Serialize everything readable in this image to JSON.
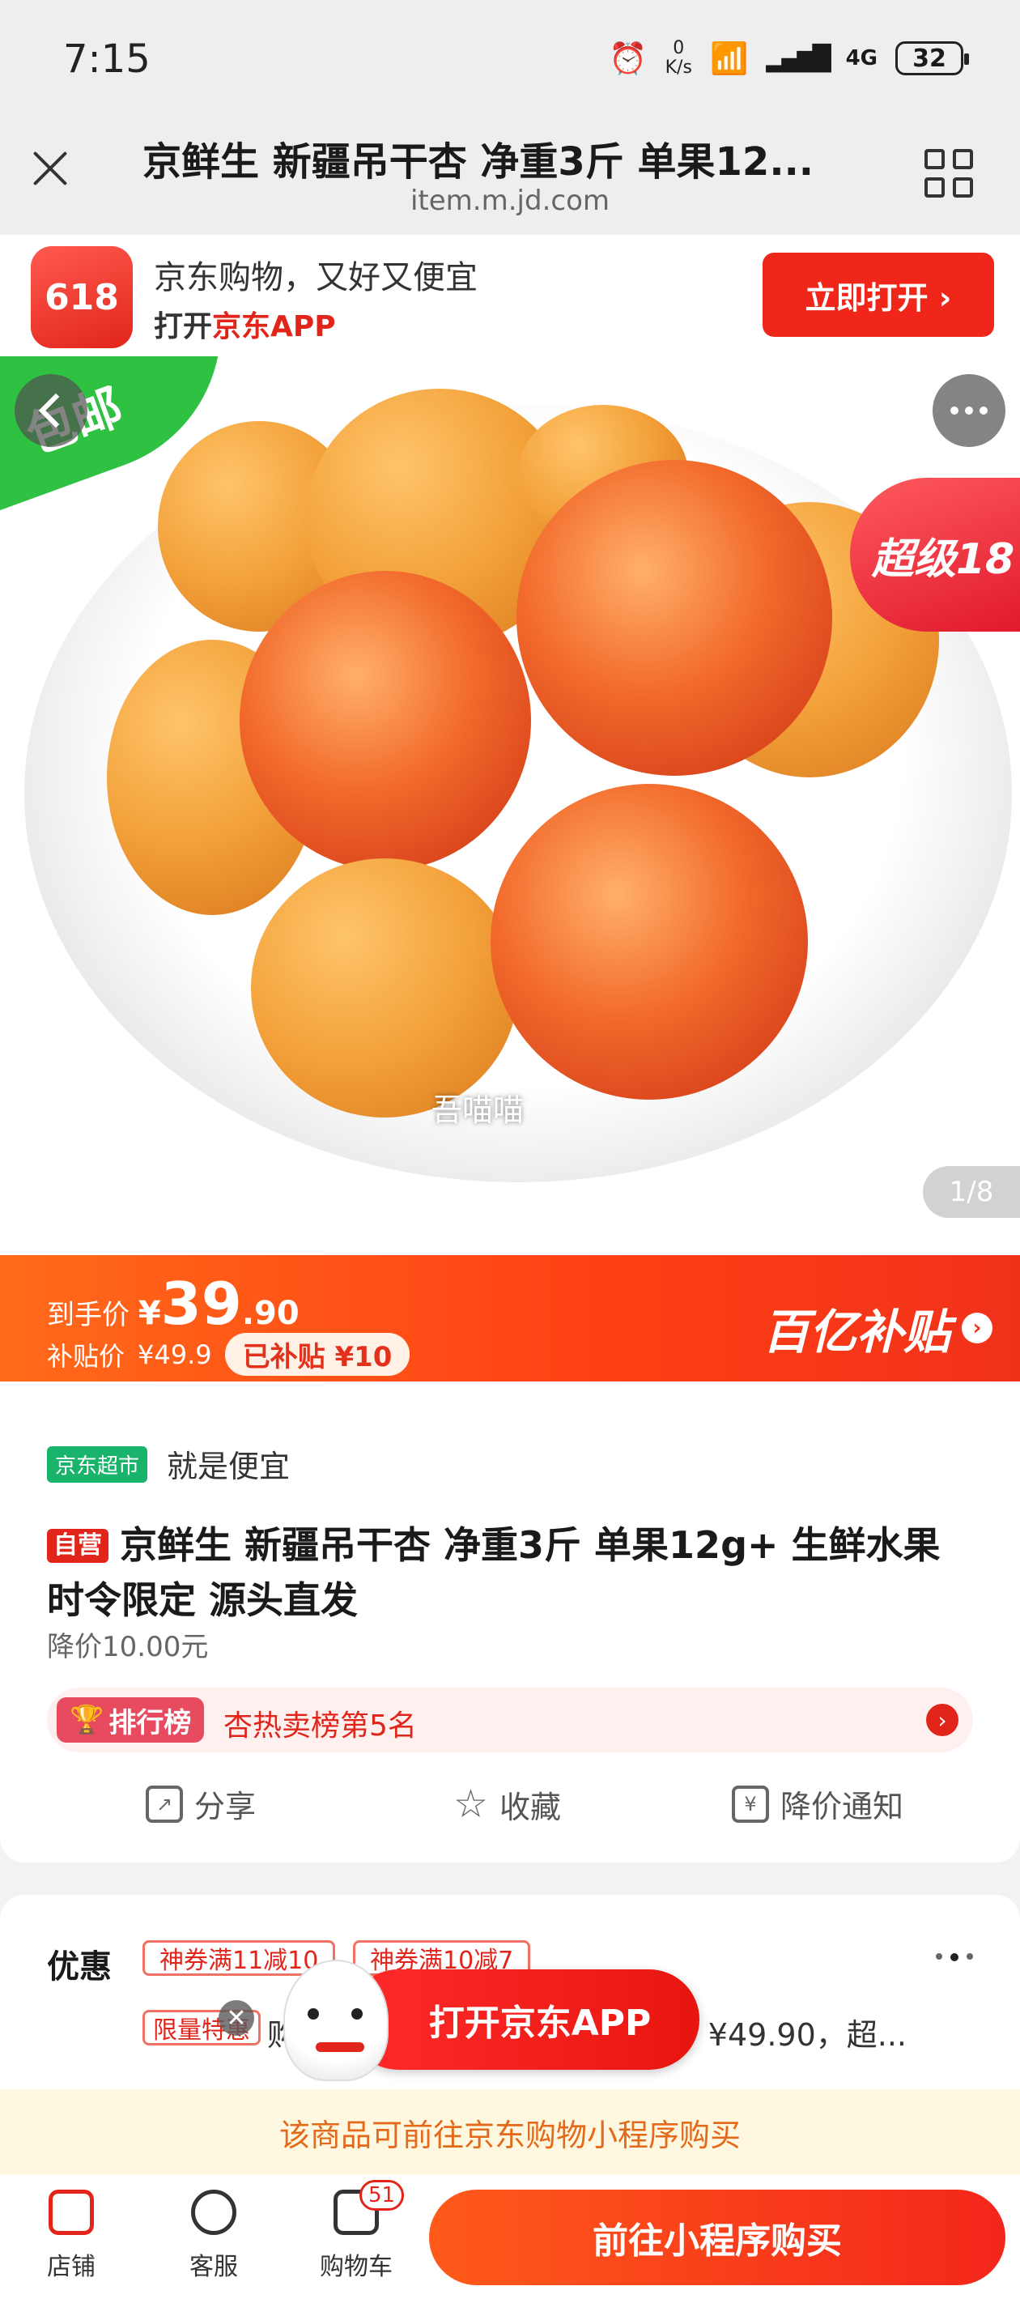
{
  "status_bar": {
    "time": "7:15",
    "net_speed_value": "0",
    "net_speed_unit": "K/s",
    "network": "4G",
    "battery": "32"
  },
  "browser": {
    "title": "京鲜生 新疆吊干杏 净重3斤 单果12...",
    "url": "item.m.jd.com"
  },
  "app_banner": {
    "logo_text": "618",
    "line1": "京东购物，又好又便宜",
    "line2_prefix": "打开",
    "line2_highlight": "京东APP",
    "open_button": "立即打开 ›"
  },
  "image": {
    "corner_tag": "包邮",
    "watermark": "吾喵喵",
    "promo_badge": "超级18",
    "counter": "1/8"
  },
  "price": {
    "label": "到手价",
    "currency": "¥",
    "integer": "39",
    "decimal": ".90",
    "subsidy_label": "补贴价",
    "subsidy_price": "¥49.9",
    "subsidy_pill": "已补贴 ¥10",
    "billion_subsidy": "百亿补贴"
  },
  "product": {
    "store_badge": "京东超市",
    "slogan": "就是便宜",
    "self_tag": "自营",
    "title": "京鲜生 新疆吊干杏 净重3斤 单果12g+ 生鲜水果 时令限定 源头直发",
    "price_drop": "降价10.00元",
    "rank_label": "排行榜",
    "rank_text": "杏热卖榜第5名"
  },
  "actions": {
    "share": "分享",
    "favorite": "收藏",
    "price_alert": "降价通知"
  },
  "coupons": {
    "title": "优惠",
    "coupon1": "神券满11减10",
    "coupon2": "神券满10减7",
    "limit_badge": "限量特惠",
    "desc": "购买",
    "desc_price": "¥49.90，超..."
  },
  "float_button": "打开京东APP",
  "notice": "该商品可前往京东购物小程序购买",
  "bottom_bar": {
    "shop": "店铺",
    "service": "客服",
    "cart": "购物车",
    "cart_count": "51",
    "buy": "前往小程序购买"
  }
}
